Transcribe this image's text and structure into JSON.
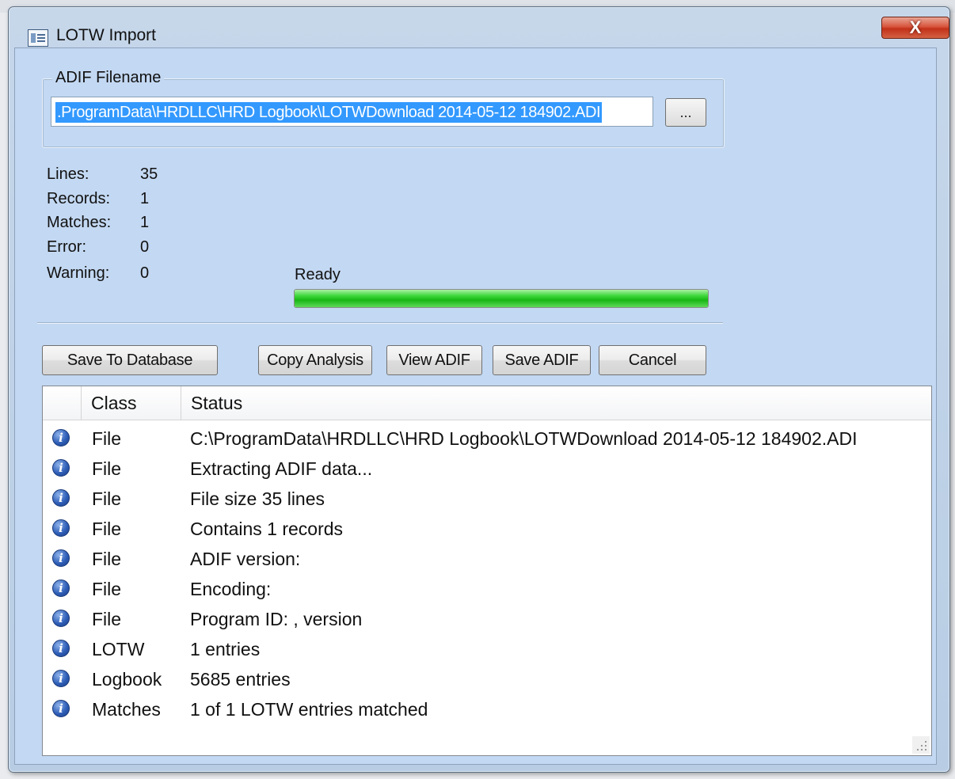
{
  "window": {
    "title": "LOTW Import",
    "close_glyph": "X"
  },
  "filename": {
    "group_label": "ADIF Filename",
    "value": ".ProgramData\\HRDLLC\\HRD Logbook\\LOTWDownload 2014-05-12 184902.ADI",
    "browse_label": "..."
  },
  "stats": [
    {
      "label": "Lines:",
      "value": "35"
    },
    {
      "label": "Records:",
      "value": "1"
    },
    {
      "label": "Matches:",
      "value": "1"
    },
    {
      "label": "Error:",
      "value": "0"
    },
    {
      "label": "Warning:",
      "value": "0"
    }
  ],
  "progress": {
    "status_text": "Ready",
    "percent": 100
  },
  "buttons": {
    "save_to_database": "Save To Database",
    "copy_analysis": "Copy Analysis",
    "view_adif": "View ADIF",
    "save_adif": "Save ADIF",
    "cancel": "Cancel"
  },
  "list": {
    "columns": [
      "Class",
      "Status"
    ],
    "rows": [
      {
        "icon": "info-icon",
        "class": "File",
        "status": "C:\\ProgramData\\HRDLLC\\HRD Logbook\\LOTWDownload 2014-05-12 184902.ADI"
      },
      {
        "icon": "info-icon",
        "class": "File",
        "status": "Extracting ADIF data..."
      },
      {
        "icon": "info-icon",
        "class": "File",
        "status": "File size 35 lines"
      },
      {
        "icon": "info-icon",
        "class": "File",
        "status": "Contains 1 records"
      },
      {
        "icon": "info-icon",
        "class": "File",
        "status": "ADIF version:"
      },
      {
        "icon": "info-icon",
        "class": "File",
        "status": "Encoding:"
      },
      {
        "icon": "info-icon",
        "class": "File",
        "status": "Program ID:  , version"
      },
      {
        "icon": "info-icon",
        "class": "LOTW",
        "status": "1 entries"
      },
      {
        "icon": "info-icon",
        "class": "Logbook",
        "status": "5685 entries"
      },
      {
        "icon": "info-icon",
        "class": "Matches",
        "status": "1 of 1 LOTW entries matched"
      }
    ]
  },
  "colors": {
    "client_bg": "#c3d8f2",
    "selection": "#3399ff",
    "progress_green": "#17b714",
    "close_red": "#c23219"
  }
}
